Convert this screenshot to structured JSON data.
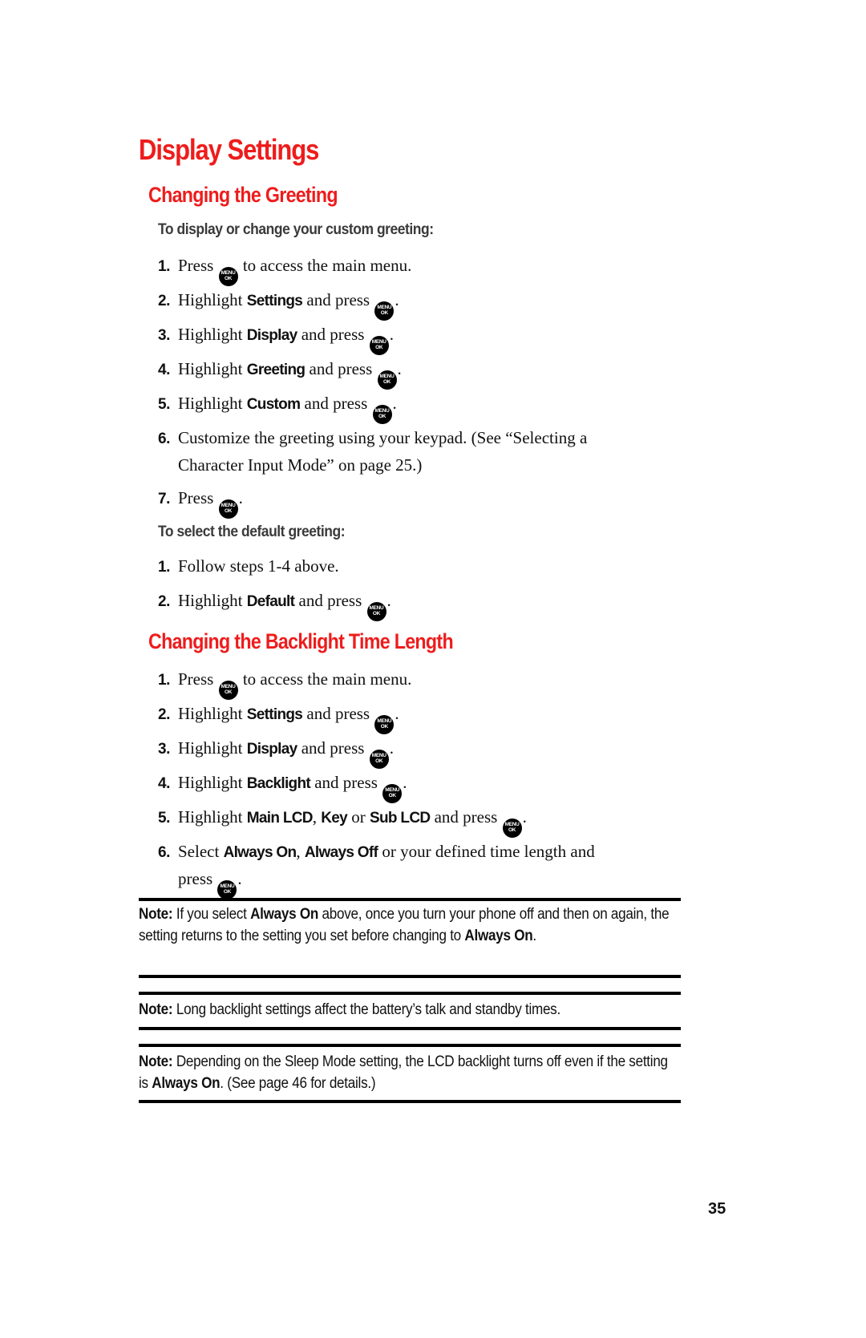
{
  "page": {
    "title": "Display Settings",
    "page_number": "35",
    "key_icon": {
      "name": "menu-ok-key-icon",
      "top": "MENU",
      "bottom": "OK"
    }
  },
  "greeting": {
    "heading": "Changing the Greeting",
    "custom": {
      "subheading": "To display or change your custom greeting:",
      "steps": [
        {
          "num": "1.",
          "pre": "Press",
          "bold": "",
          "post": "to access the main menu."
        },
        {
          "num": "2.",
          "pre": "Highlight",
          "bold": "Settings",
          "post": "and press"
        },
        {
          "num": "3.",
          "pre": "Highlight",
          "bold": "Display",
          "post": "and press"
        },
        {
          "num": "4.",
          "pre": "Highlight",
          "bold": "Greeting",
          "post": "and press"
        },
        {
          "num": "5.",
          "pre": "Highlight",
          "bold": "Custom",
          "post": "and press"
        },
        {
          "num": "6.",
          "line1": "Customize the greeting using your keypad. (See “Selecting a",
          "line2": "Character Input Mode” on page 25.)"
        },
        {
          "num": "7.",
          "pre": "Press"
        }
      ]
    },
    "default": {
      "subheading": "To select the default greeting:",
      "steps": [
        {
          "num": "1.",
          "text": "Follow steps 1-4 above."
        },
        {
          "num": "2.",
          "pre": "Highlight",
          "bold": "Default",
          "post": "and press"
        }
      ]
    }
  },
  "backlight": {
    "heading": "Changing the Backlight Time Length",
    "steps": [
      {
        "num": "1.",
        "pre": "Press",
        "post": "to access the main menu."
      },
      {
        "num": "2.",
        "pre": "Highlight",
        "bold": "Settings",
        "post": "and press"
      },
      {
        "num": "3.",
        "pre": "Highlight",
        "bold": "Display",
        "post": "and press"
      },
      {
        "num": "4.",
        "pre": "Highlight",
        "bold": "Backlight",
        "post": "and press"
      },
      {
        "num": "5.",
        "pre": "Highlight",
        "bold1": "Main LCD",
        "sep1": ",",
        "bold2": "Key",
        "sep2": "or",
        "bold3": "Sub LCD",
        "post": "and press"
      },
      {
        "num": "6.",
        "pre": "Select",
        "bold1": "Always On",
        "sep1": ",",
        "bold2": "Always Off",
        "post": "or your defined time length and",
        "line2": "press"
      }
    ]
  },
  "notes": [
    {
      "label": "Note:",
      "text1": "If you select",
      "bold1": "Always On",
      "text2": "above, once you turn your phone off and then on again, the setting returns to the setting you set before changing to",
      "bold2": "Always On",
      "text3": "."
    },
    {
      "label": "Note:",
      "text1": "Long backlight settings affect the battery’s talk and standby times."
    },
    {
      "label": "Note:",
      "text1": "Depending on the Sleep Mode setting, the LCD backlight turns off even if the setting is",
      "bold1": "Always On",
      "text2": ". (See page 46 for details.)"
    }
  ]
}
